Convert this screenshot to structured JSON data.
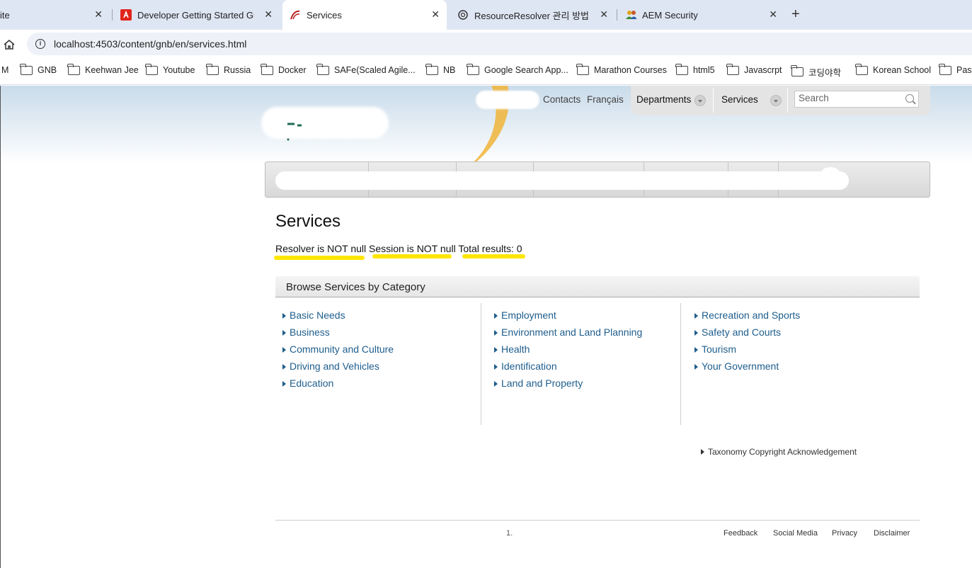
{
  "browser": {
    "tabs": [
      {
        "title": "ite",
        "close": "✕"
      },
      {
        "title": "Developer Getting Started Guid",
        "close": "✕"
      },
      {
        "title": "Services",
        "close": "✕"
      },
      {
        "title": "ResourceResolver 관리 방법",
        "close": "✕"
      },
      {
        "title": "AEM Security",
        "close": "✕"
      }
    ],
    "new_tab": "+",
    "url": "localhost:4503/content/gnb/en/services.html",
    "bookmarks": [
      "M",
      "GNB",
      "Keehwan Jee",
      "Youtube",
      "Russia",
      "Docker",
      "SAFe(Scaled Agile...",
      "NB",
      "Google Search App...",
      "Marathon Courses",
      "html5",
      "Javascrpt",
      "코딩야학",
      "Korean School",
      "Past"
    ]
  },
  "header": {
    "contacts": "Contacts",
    "language": "Français",
    "departments": "Departments",
    "services": "Services",
    "search_placeholder": "Search"
  },
  "main": {
    "title": "Services",
    "status": "Resolver is NOT null Session is NOT null Total results: 0",
    "highlight_color": "#ffe600",
    "category_title": "Browse Services by Category",
    "columns": [
      [
        "Basic Needs",
        "Business",
        "Community and Culture",
        "Driving and Vehicles",
        "Education"
      ],
      [
        "Employment",
        "Environment and Land Planning",
        "Health",
        "Identification",
        "Land and Property"
      ],
      [
        "Recreation and Sports",
        "Safety and Courts",
        "Tourism",
        "Your Government"
      ]
    ],
    "taxonomy_link": "Taxonomy Copyright Acknowledgement",
    "link_color": "#1e5d8c"
  },
  "footer": {
    "number": "1.",
    "links": [
      "Feedback",
      "Social Media",
      "Privacy",
      "Disclaimer"
    ]
  }
}
